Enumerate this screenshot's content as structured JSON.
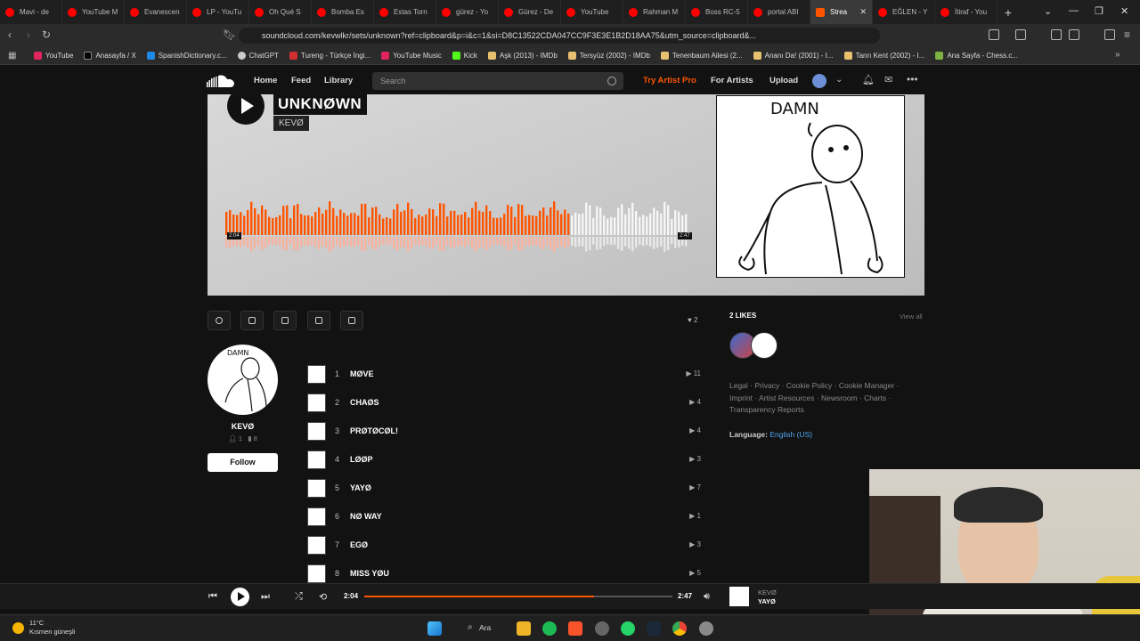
{
  "browser": {
    "tabs": [
      {
        "label": "Mavi - de",
        "icon": "youtube-icon"
      },
      {
        "label": "YouTube M",
        "icon": "youtube-icon"
      },
      {
        "label": "Evanescen",
        "icon": "youtube-icon"
      },
      {
        "label": "LP - YouTu",
        "icon": "youtube-icon"
      },
      {
        "label": "Oh Qué S",
        "icon": "youtube-icon"
      },
      {
        "label": "Bomba Es",
        "icon": "youtube-icon"
      },
      {
        "label": "Estas Torn",
        "icon": "youtube-icon"
      },
      {
        "label": "gürez - Yo",
        "icon": "youtube-icon"
      },
      {
        "label": "Gürez - De",
        "icon": "youtube-icon"
      },
      {
        "label": "YouTube",
        "icon": "youtube-icon"
      },
      {
        "label": "Rahman M",
        "icon": "youtube-icon"
      },
      {
        "label": "Boss RC-5",
        "icon": "youtube-icon"
      },
      {
        "label": "portal ABI",
        "icon": "youtube-icon"
      },
      {
        "label": "Strea",
        "icon": "soundcloud-icon",
        "active": true
      },
      {
        "label": "EĞLEN - Y",
        "icon": "youtube-icon"
      },
      {
        "label": "İtiraf - You",
        "icon": "youtube-icon"
      }
    ],
    "url": "soundcloud.com/kevwlkr/sets/unknown?ref=clipboard&p=i&c=1&si=D8C13522CDA047CC9F3E3E1B2D18AA75&utm_source=clipboard&...",
    "bookmarks": [
      {
        "label": "YouTube",
        "icon": "youtube"
      },
      {
        "label": "Anasayfa / X",
        "icon": "x"
      },
      {
        "label": "SpanishDictionary.c...",
        "icon": "sd"
      },
      {
        "label": "ChatGPT",
        "icon": "gpt"
      },
      {
        "label": "Tureng - Türkçe İngi...",
        "icon": "t"
      },
      {
        "label": "YouTube Music",
        "icon": "youtube"
      },
      {
        "label": "Kick",
        "icon": "k"
      },
      {
        "label": "Aşk (2013) - IMDb",
        "icon": "folder"
      },
      {
        "label": "Tersyüz (2002) - IMDb",
        "icon": "folder"
      },
      {
        "label": "Tenenbaum Ailesi (2...",
        "icon": "folder"
      },
      {
        "label": "Ananı Da! (2001) - I...",
        "icon": "folder"
      },
      {
        "label": "Tanrı Kent (2002) - I...",
        "icon": "folder"
      },
      {
        "label": "Ana Sayfa - Chess.c...",
        "icon": "ch"
      }
    ]
  },
  "header": {
    "home": "Home",
    "feed": "Feed",
    "library": "Library",
    "search_placeholder": "Search",
    "try_pro": "Try Artist Pro",
    "for_artists": "For Artists",
    "upload": "Upload"
  },
  "hero": {
    "title": "UNKNØWN",
    "artist": "KEVØ",
    "time_left": "2:04",
    "time_right": "2:47",
    "played_fraction": 0.745,
    "wave_color": "#ff5500"
  },
  "actions": {
    "like_count": "2"
  },
  "artist": {
    "name": "KEVØ",
    "followers": "1",
    "tracks": "8",
    "follow_label": "Follow"
  },
  "tracks": [
    {
      "num": "1",
      "name": "MØVE",
      "plays": "11"
    },
    {
      "num": "2",
      "name": "CHAØS",
      "plays": "4"
    },
    {
      "num": "3",
      "name": "PRØTØCØL!",
      "plays": "4"
    },
    {
      "num": "4",
      "name": "LØØP",
      "plays": "3"
    },
    {
      "num": "5",
      "name": "YAYØ",
      "plays": "7"
    },
    {
      "num": "6",
      "name": "NØ WAY",
      "plays": "1"
    },
    {
      "num": "7",
      "name": "EGØ",
      "plays": "3"
    },
    {
      "num": "8",
      "name": "MISS YØU",
      "plays": "5"
    }
  ],
  "sidebar": {
    "likes_heading": "2 LIKES",
    "view_all": "View all",
    "footer_links": "Legal · Privacy · Cookie Policy · Cookie Manager · Imprint · Artist Resources · Newsroom · Charts · Transparency Reports",
    "language_label": "Language:",
    "language_value": "English (US)"
  },
  "player": {
    "current": "2:04",
    "duration": "2:47",
    "progress_fraction": 0.745,
    "artist": "KEVØ",
    "title": "YAYØ"
  },
  "taskbar": {
    "temp": "11°C",
    "weather": "Kısmen güneşli",
    "search_label": "Ara"
  }
}
